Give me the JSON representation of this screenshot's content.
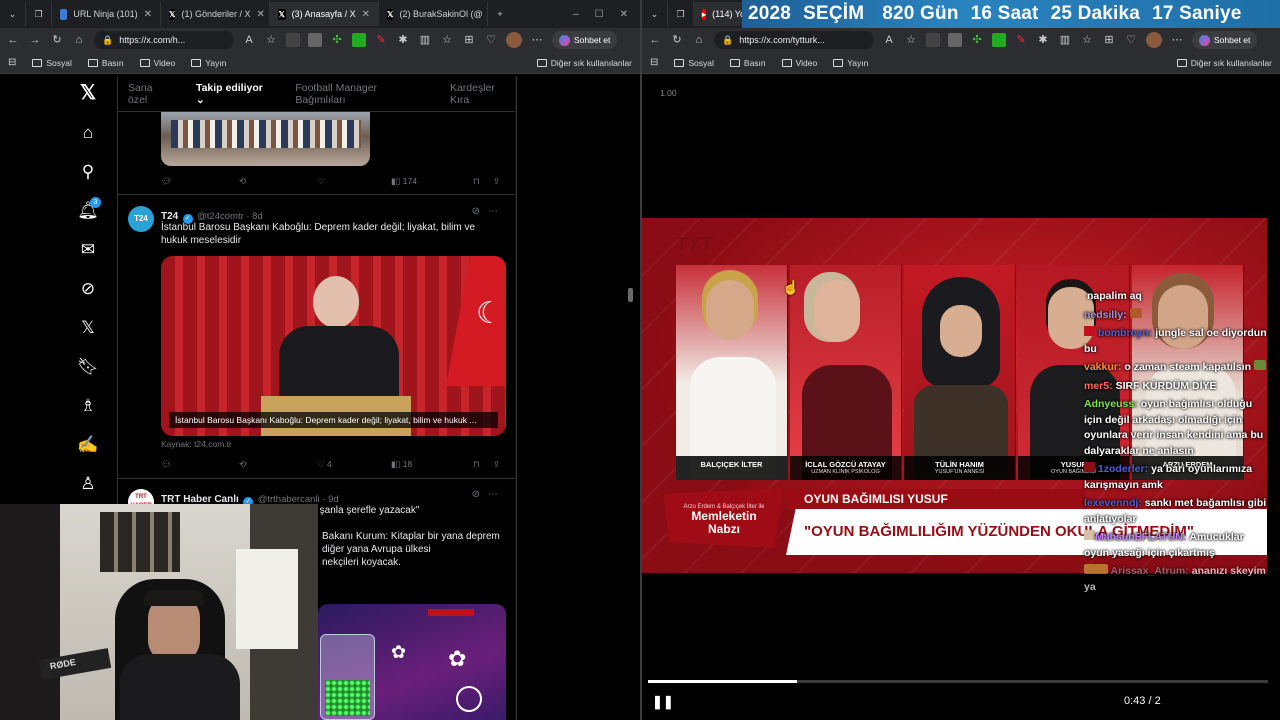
{
  "left_browser": {
    "tabs": [
      {
        "label": "URL Ninja (101)",
        "icon": "ninja-favicon"
      },
      {
        "label": "(1) Gönderiler / X",
        "icon": "x-favicon"
      },
      {
        "label": "(3) Anasayfa / X",
        "icon": "x-favicon"
      },
      {
        "label": "(2) BurakSakinOl (@",
        "icon": "x-favicon"
      }
    ],
    "url": "https://x.com/h...",
    "chat_button": "Sohbet et",
    "bookmarks": [
      "Sosyal",
      "Basın",
      "Video",
      "Yayın"
    ],
    "other_bookmarks": "Diğer sık kullanılanlar"
  },
  "right_browser": {
    "tab_label": "(114) Yo",
    "url": "https://x.com/tytturk...",
    "chat_button": "Sohbet et",
    "bookmarks": [
      "Sosyal",
      "Basın",
      "Video",
      "Yayın"
    ],
    "other_bookmarks": "Diğer sık kullanılanlar"
  },
  "countdown": {
    "year": "2028",
    "title": "SEÇİM",
    "days": "820 Gün",
    "hours": "16 Saat",
    "minutes": "25 Dakika",
    "seconds": "17 Saniye"
  },
  "x_nav": {
    "notifications_badge": "3"
  },
  "feed": {
    "tabs": [
      "Sana özel",
      "Takip ediliyor",
      "Football Manager Bağımlıları",
      "Kardeşler Kıra"
    ],
    "active_tab": 1,
    "top_post_stats": {
      "views": "174"
    },
    "post1": {
      "name": "T24",
      "avatar": "T24",
      "handle": "@t24comtr · 8d",
      "text": "İstanbul Barosu Başkanı Kaboğlu: Deprem kader değil; liyakat, bilim ve hukuk meselesidir",
      "media_caption": "İstanbul Barosu Başkanı Kaboğlu: Deprem kader değil; liyakat, bilim ve hukuk ...",
      "source": "Kaynak: t24.com.tr",
      "likes": "4",
      "views": "18"
    },
    "post2": {
      "name": "TRT Haber Canlı",
      "avatar": "TRT HABER",
      "handle": "@trthabercanli · 9d",
      "text_line1": "...ıyı şanla şerefle yazacak\"",
      "text_line2": "Bakanı Kurum: Kitaplar bir yana deprem",
      "text_line3": "diğer yana Avrupa ülkesi",
      "text_line4": "nekçileri koyacak."
    }
  },
  "stream": {
    "speed": "1.00",
    "logo": "TYT",
    "people": [
      {
        "name": "BALÇIÇEK İLTER",
        "role": ""
      },
      {
        "name": "İCLAL GÖZCÜ ATAYAY",
        "role": "UZMAN KLİNİK PSİKOLOG"
      },
      {
        "name": "TÜLİN HANIM",
        "role": "YUSUF'UN ANNESİ"
      },
      {
        "name": "YUSUF",
        "role": "OYUN BAĞIMLISI"
      },
      {
        "name": "ARZU ERDEM",
        "role": ""
      }
    ],
    "show_subtitle": "Arzu Erdem & Balçıçek İlter ile",
    "show_name": "Memleketin Nabzı",
    "lower_title": "OYUN BAĞIMLISI YUSUF",
    "quote": "\"OYUN BAĞIMLILIĞIM YÜZÜNDEN OKULA GİTMEDİM\"",
    "time": "0:43 / 2",
    "progress_fraction": 0.24
  },
  "chat": [
    {
      "user": "",
      "text": "napalim aq",
      "color": "#ffffff"
    },
    {
      "user": "nedsilly:",
      "text": "",
      "color": "#a98ee6"
    },
    {
      "user": "bombreyn:",
      "text": "jungle sal oe diyordun bu",
      "color": "#4b5fd6"
    },
    {
      "user": "vakkur:",
      "text": "o zaman steam kapatılsın",
      "color": "#ff8c3a"
    },
    {
      "user": "mer5:",
      "text": "SIRF KÜRDÜM DİYE",
      "color": "#ff6a5a"
    },
    {
      "user": "Adnyeuss:",
      "text": "oyun bağımlısı olduğu için değil arkadaşı olmadığı için oyunlara verir insan kendini ama bu dalyaraklar ne anlasın",
      "color": "#7ee05a"
    },
    {
      "user": "1zoderler:",
      "text": "ya bari oyunlarımıza karışmayın amk",
      "color": "#4b5fd6"
    },
    {
      "user": "lexevenndj:",
      "text": "sankı met bağamlısı gibi anlatıyolar",
      "color": "#4b5fd6"
    },
    {
      "user": "MahsunEFLATUN:",
      "text": "Amucuklar oyun yasağı için çıkartmış",
      "color": "#c77dff"
    },
    {
      "user": "Arissax_Atrum:",
      "text": "ananızı skeyim ya",
      "color": "#8a8a8a"
    }
  ],
  "webcam": {
    "mic_label": "RØDE"
  },
  "colors": {
    "x_blue": "#1d9bf0",
    "tyt_red": "#c4101c",
    "countdown_bg": "#1f6fa8"
  }
}
